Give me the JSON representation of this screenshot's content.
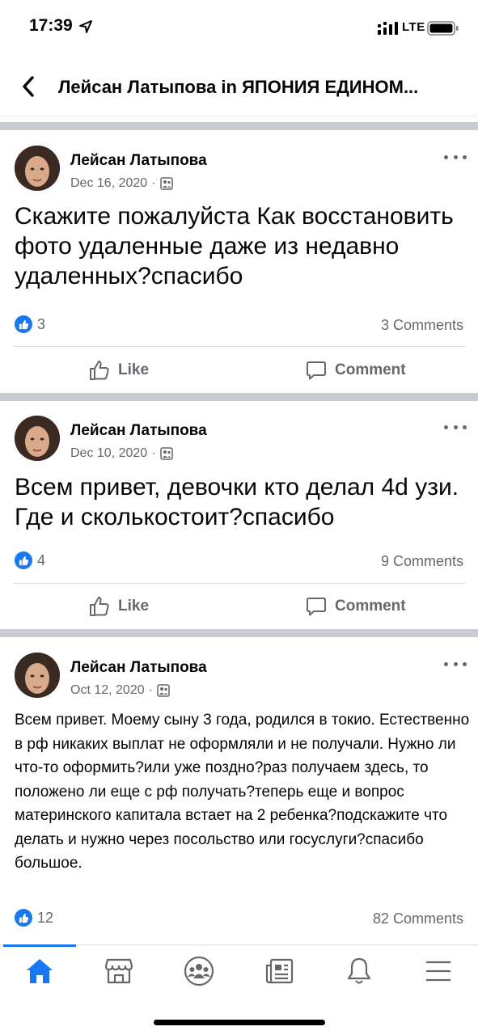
{
  "status_bar": {
    "time": "17:39",
    "network": "LTE"
  },
  "header": {
    "back_label": "Back",
    "title": "Лейсан Латыпова in ЯПОНИЯ ЕДИНОМ..."
  },
  "posts": [
    {
      "author": "Лейсан Латыпова",
      "date": "Dec 16, 2020",
      "separator": "·",
      "text": "Скажите пожалуйста Как восстановить фото удаленные даже из недавно удаленных?спасибо",
      "reactions": "3",
      "comments": "3 Comments",
      "like_label": "Like",
      "comment_label": "Comment"
    },
    {
      "author": "Лейсан Латыпова",
      "date": "Dec 10, 2020",
      "separator": "·",
      "text": "Всем привет, девочки кто делал 4d узи. Где и сколькостоит?спасибо",
      "reactions": "4",
      "comments": "9 Comments",
      "like_label": "Like",
      "comment_label": "Comment"
    },
    {
      "author": "Лейсан Латыпова",
      "date": "Oct 12, 2020",
      "separator": "·",
      "text": "Всем привет. Моему сыну 3 года, родился в токио. Естественно в рф никаких выплат не оформляли и не получали. Нужно ли что-то оформить?или уже поздно?раз получаем здесь, то положено ли еще с рф получать?теперь еще и вопрос материнского капитала встает на 2 ребенка?подскажите что делать и нужно через посольство или госуслуги?спасибо большое.",
      "reactions": "12",
      "comments": "82 Comments"
    }
  ],
  "tab_bar": {
    "tabs": [
      "home-icon",
      "marketplace-icon",
      "groups-icon",
      "news-icon",
      "bell-icon",
      "menu-icon"
    ],
    "active": "home-icon"
  },
  "colors": {
    "accent": "#1877f2",
    "muted": "#65676b",
    "divider": "#c9ccd1"
  }
}
